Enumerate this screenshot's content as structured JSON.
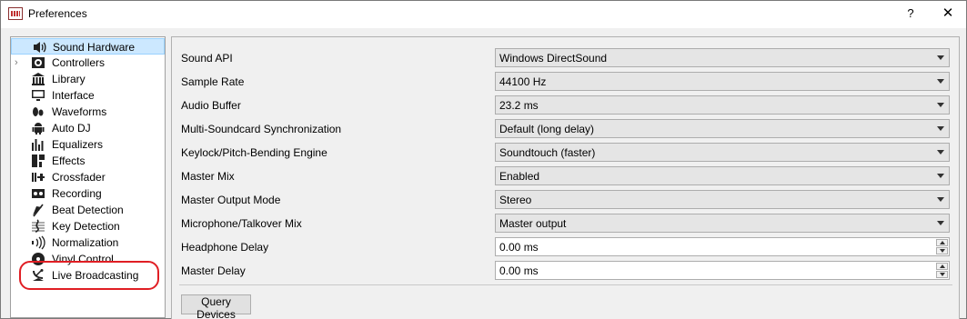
{
  "window": {
    "title": "Preferences",
    "help_glyph": "?",
    "close_glyph": "✕"
  },
  "sidebar": {
    "items": [
      {
        "label": "Sound Hardware",
        "icon": "speaker-icon",
        "selected": true
      },
      {
        "label": "Controllers",
        "icon": "controller-icon",
        "expandable": true
      },
      {
        "label": "Library",
        "icon": "library-icon"
      },
      {
        "label": "Interface",
        "icon": "monitor-icon"
      },
      {
        "label": "Waveforms",
        "icon": "waveform-icon"
      },
      {
        "label": "Auto DJ",
        "icon": "robot-icon"
      },
      {
        "label": "Equalizers",
        "icon": "equalizer-icon"
      },
      {
        "label": "Effects",
        "icon": "effects-icon"
      },
      {
        "label": "Crossfader",
        "icon": "crossfader-icon"
      },
      {
        "label": "Recording",
        "icon": "recording-icon"
      },
      {
        "label": "Beat Detection",
        "icon": "beat-detection-icon"
      },
      {
        "label": "Key Detection",
        "icon": "key-detection-icon"
      },
      {
        "label": "Normalization",
        "icon": "normalization-icon"
      },
      {
        "label": "Vinyl Control",
        "icon": "vinyl-icon"
      },
      {
        "label": "Live Broadcasting",
        "icon": "broadcast-icon",
        "highlighted": true
      }
    ],
    "expander_glyph": "›"
  },
  "form": {
    "rows": [
      {
        "label": "Sound API",
        "type": "combo",
        "value": "Windows DirectSound"
      },
      {
        "label": "Sample Rate",
        "type": "combo",
        "value": "44100 Hz"
      },
      {
        "label": "Audio Buffer",
        "type": "combo",
        "value": "23.2 ms"
      },
      {
        "label": "Multi-Soundcard Synchronization",
        "type": "combo",
        "value": "Default (long delay)"
      },
      {
        "label": "Keylock/Pitch-Bending Engine",
        "type": "combo",
        "value": "Soundtouch (faster)"
      },
      {
        "label": "Master Mix",
        "type": "combo",
        "value": "Enabled"
      },
      {
        "label": "Master Output Mode",
        "type": "combo",
        "value": "Stereo"
      },
      {
        "label": "Microphone/Talkover Mix",
        "type": "combo",
        "value": "Master output"
      },
      {
        "label": "Headphone Delay",
        "type": "spin",
        "value": "0.00 ms"
      },
      {
        "label": "Master Delay",
        "type": "spin",
        "value": "0.00 ms"
      }
    ],
    "query_button_label": "Query Devices"
  },
  "colors": {
    "selection_bg": "#cce8ff",
    "highlight_ring": "#e01e24"
  }
}
